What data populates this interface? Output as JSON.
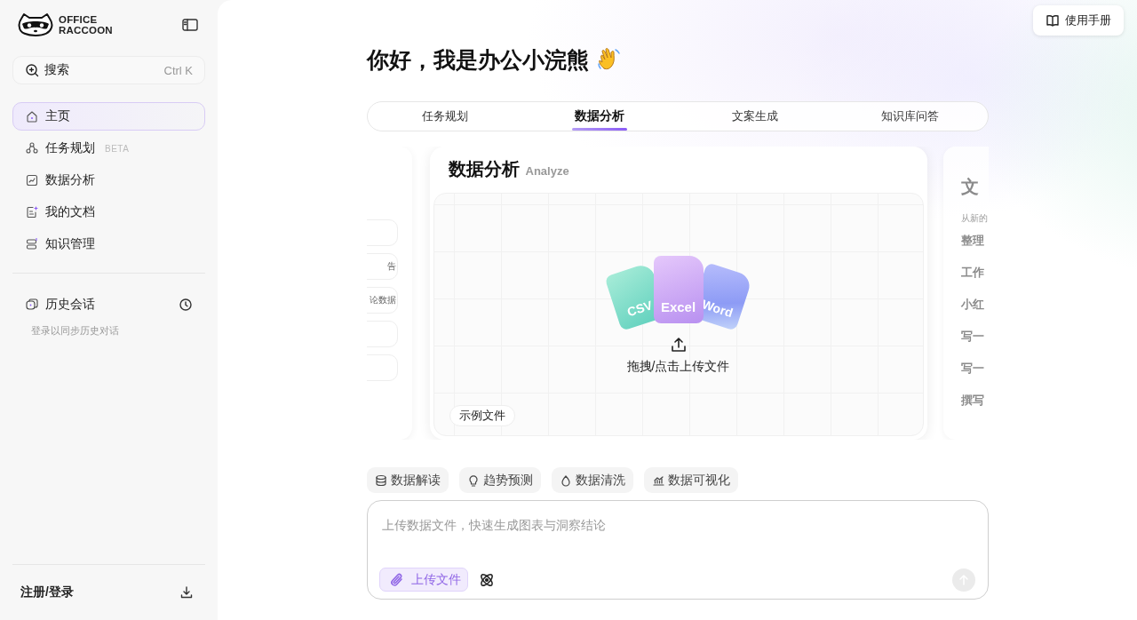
{
  "sidebar": {
    "logo": [
      "OFFICE",
      "RACCOON"
    ],
    "search": {
      "label": "搜索",
      "shortcut": "Ctrl K"
    },
    "nav": [
      {
        "label": "主页",
        "selected": true
      },
      {
        "label": "任务规划",
        "badge": "BETA",
        "selected": false
      },
      {
        "label": "数据分析",
        "selected": false
      },
      {
        "label": "我的文档",
        "selected": false
      },
      {
        "label": "知识管理",
        "selected": false
      }
    ],
    "history": {
      "title": "历史会话",
      "hint": "登录以同步历史对话"
    },
    "account": "注册/登录"
  },
  "manual_button": "使用手册",
  "greeting": "你好，我是办公小浣熊",
  "tabs": [
    {
      "label": "任务规划",
      "selected": false
    },
    {
      "label": "数据分析",
      "selected": true
    },
    {
      "label": "文案生成",
      "selected": false
    },
    {
      "label": "知识库问答",
      "selected": false
    }
  ],
  "cards": {
    "left": {
      "items": [
        "告",
        "论数据"
      ]
    },
    "center": {
      "title": "数据分析",
      "subtitle": "Analyze",
      "files": [
        "CSV",
        "Excel",
        "Word"
      ],
      "upload": "拖拽/点击上传文件",
      "sample": "示例文件"
    },
    "right": {
      "title": "文",
      "subtitle": "从新的",
      "items": [
        "整理",
        "工作",
        "小红",
        "写一",
        "写一",
        "撰写"
      ]
    }
  },
  "chips": [
    "数据解读",
    "趋势预测",
    "数据清洗",
    "数据可视化"
  ],
  "composer": {
    "placeholder": "上传数据文件，快速生成图表与洞察结论",
    "upload": "上传文件"
  }
}
